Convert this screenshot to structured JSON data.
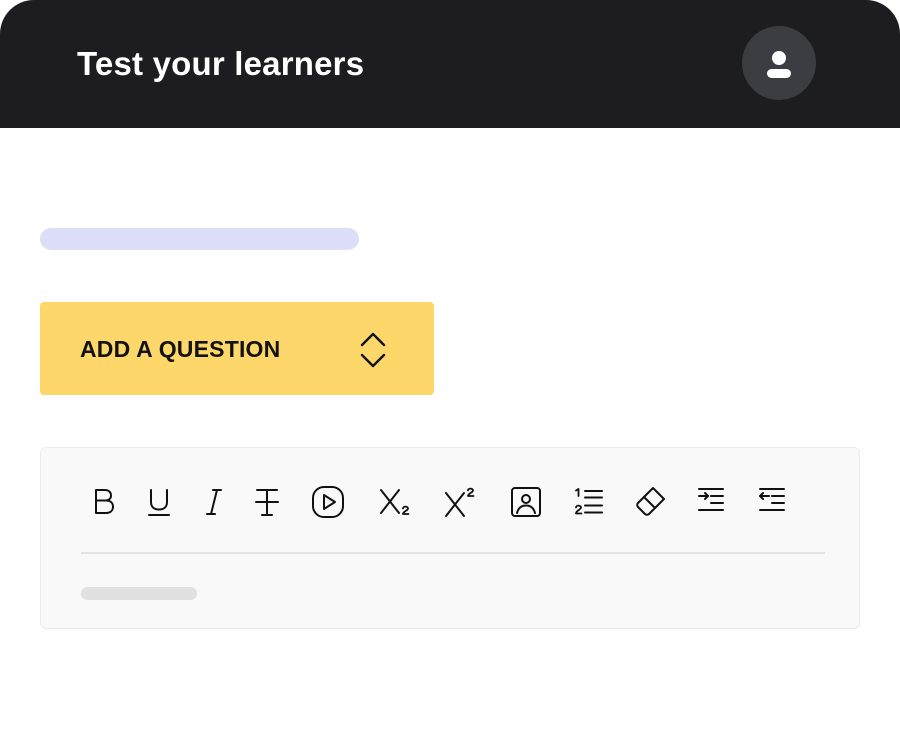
{
  "header": {
    "title": "Test your learners",
    "avatar_icon": "user-icon"
  },
  "main": {
    "add_question_label": "ADD A QUESTION",
    "add_question_icon": "chevron-up-down-icon"
  },
  "editor": {
    "toolbar": [
      {
        "name": "bold-icon",
        "label": "Bold"
      },
      {
        "name": "underline-icon",
        "label": "Underline"
      },
      {
        "name": "italic-icon",
        "label": "Italic"
      },
      {
        "name": "strikethrough-icon",
        "label": "Strikethrough"
      },
      {
        "name": "video-icon",
        "label": "Video"
      },
      {
        "name": "subscript-icon",
        "label": "Subscript"
      },
      {
        "name": "superscript-icon",
        "label": "Superscript"
      },
      {
        "name": "image-icon",
        "label": "Image"
      },
      {
        "name": "ordered-list-icon",
        "label": "Numbered list"
      },
      {
        "name": "eraser-icon",
        "label": "Clear formatting"
      },
      {
        "name": "indent-icon",
        "label": "Indent"
      },
      {
        "name": "outdent-icon",
        "label": "Outdent"
      }
    ]
  },
  "colors": {
    "header_bg": "#1d1d21",
    "avatar_bg": "#3b3d43",
    "accent_yellow": "#fed76b",
    "skeleton_blue": "#dcdff7",
    "editor_bg": "#f9f9f9"
  }
}
